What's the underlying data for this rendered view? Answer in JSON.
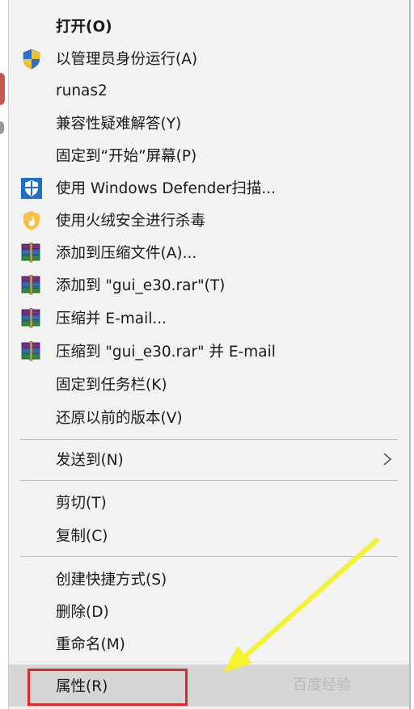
{
  "menu": {
    "items": [
      {
        "label": "打开(O)",
        "icon": "",
        "bold": true
      },
      {
        "label": "以管理员身份运行(A)",
        "icon": "uac-shield-icon"
      },
      {
        "label": "runas2",
        "icon": ""
      },
      {
        "label": "兼容性疑难解答(Y)",
        "icon": ""
      },
      {
        "label": "固定到“开始”屏幕(P)",
        "icon": ""
      },
      {
        "label": "使用 Windows Defender扫描...",
        "icon": "windows-defender-icon"
      },
      {
        "label": "使用火绒安全进行杀毒",
        "icon": "huorong-icon"
      },
      {
        "label": "添加到压缩文件(A)...",
        "icon": "winrar-icon"
      },
      {
        "label": "添加到 \"gui_e30.rar\"(T)",
        "icon": "winrar-icon"
      },
      {
        "label": "压缩并 E-mail...",
        "icon": "winrar-icon"
      },
      {
        "label": "压缩到 \"gui_e30.rar\" 并 E-mail",
        "icon": "winrar-icon"
      },
      {
        "label": "固定到任务栏(K)",
        "icon": ""
      },
      {
        "label": "还原以前的版本(V)",
        "icon": ""
      }
    ],
    "send_to": {
      "label": "发送到(N)",
      "icon": "chevron-right-icon"
    },
    "clipboard": [
      {
        "label": "剪切(T)"
      },
      {
        "label": "复制(C)"
      }
    ],
    "manage": [
      {
        "label": "创建快捷方式(S)"
      },
      {
        "label": "删除(D)"
      },
      {
        "label": "重命名(M)"
      }
    ],
    "properties": {
      "label": "属性(R)",
      "highlighted": true
    }
  },
  "watermark": "百度经验",
  "colors": {
    "menu_bg": "#f2f2f2",
    "hover_bg": "#d6d6d6",
    "highlight_box": "#d92b2b",
    "annotation_arrow": "#f5f22a"
  }
}
